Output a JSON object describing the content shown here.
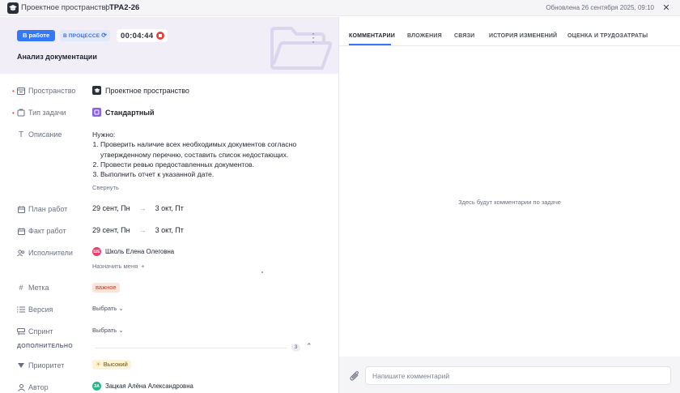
{
  "topbar": {
    "space_name": "Проектное пространство",
    "separator": "|",
    "task_key": "TPA2-26",
    "updated_text": "Обновлена 26 сентября 2025, 09:10",
    "close_icon": "close-icon"
  },
  "header": {
    "status_label": "В работе",
    "process_label": "В ПРОЦЕССЕ",
    "timer_value": "00:04:44",
    "title": "Анализ документации"
  },
  "fields": {
    "space": {
      "label": "Пространство",
      "value": "Проектное пространство",
      "required": true
    },
    "task_type": {
      "label": "Тип задачи",
      "value": "Стандартный",
      "required": true
    },
    "description": {
      "label": "Описание",
      "intro": "Нужно:",
      "items": [
        "Проверить наличие всех необходимых документов согласно утвержденному перечню, составить список недостающих.",
        "Провести ревью предоставленных документов.",
        "Выполнить отчет к указанной дате."
      ],
      "collapse_label": "Свернуть"
    },
    "plan": {
      "label": "План работ",
      "start": "29 сент, Пн",
      "end": "3 окт, Пт"
    },
    "fact": {
      "label": "Факт работ",
      "start": "29 сент, Пн",
      "end": "3 окт, Пт"
    },
    "assignees": {
      "label": "Исполнители",
      "avatar_initials": "ШЕ",
      "avatar_color": "#e83e6c",
      "name": "Школь Елена Олеговна",
      "assign_me_label": "Назначить меня"
    },
    "tag": {
      "label": "Метка",
      "value": "важное"
    },
    "version": {
      "label": "Версия",
      "value": "Выбрать"
    },
    "sprint": {
      "label": "Спринт",
      "value": "Выбрать"
    }
  },
  "additional": {
    "section_label": "ДОПОЛНИТЕЛЬНО",
    "count": "3",
    "priority": {
      "label": "Приоритет",
      "value": "Высокий"
    },
    "author": {
      "label": "Автор",
      "avatar_initials": "ЗА",
      "avatar_color": "#2bb58a",
      "name": "Зацкая Алёна Александровна"
    }
  },
  "tabs": [
    {
      "label": "КОММЕНТАРИИ",
      "active": true
    },
    {
      "label": "ВЛОЖЕНИЯ"
    },
    {
      "label": "СВЯЗИ"
    },
    {
      "label": "ИСТОРИЯ ИЗМЕНЕНИЙ"
    },
    {
      "label": "ОЦЕНКА И ТРУДОЗАТРАТЫ"
    }
  ],
  "comments": {
    "empty_text": "Здесь будут комментарии по задаче",
    "input_placeholder": "Напишите комментарий"
  },
  "colors": {
    "accent": "#3478f6",
    "header_bg": "#f1eef8",
    "required_mark": "#e5413c",
    "task_type_icon": "#8a63e8"
  }
}
